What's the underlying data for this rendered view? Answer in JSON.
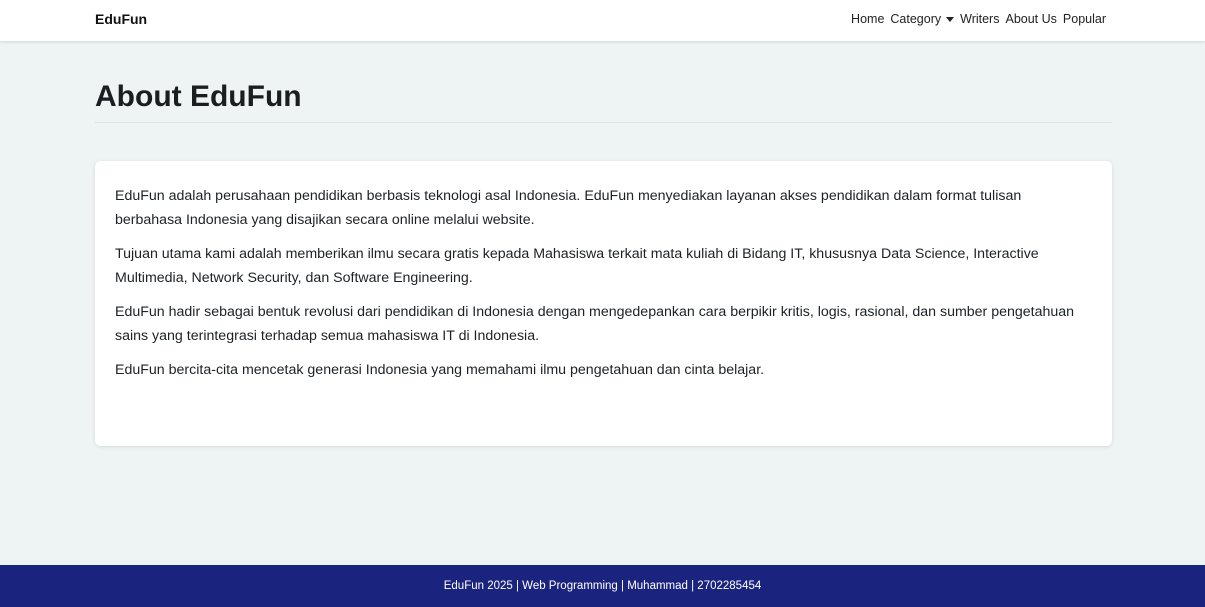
{
  "navbar": {
    "brand": "EduFun",
    "links": {
      "home": "Home",
      "category": "Category",
      "writers": "Writers",
      "about": "About Us",
      "popular": "Popular"
    }
  },
  "main": {
    "title": "About EduFun",
    "paragraphs": [
      "EduFun adalah perusahaan pendidikan berbasis teknologi asal Indonesia. EduFun menyediakan layanan akses pendidikan dalam format tulisan berbahasa Indonesia yang disajikan secara online melalui website.",
      "Tujuan utama kami adalah memberikan ilmu secara gratis kepada Mahasiswa terkait mata kuliah di Bidang IT, khususnya Data Science, Interactive Multimedia, Network Security, dan Software Engineering.",
      "EduFun hadir sebagai bentuk revolusi dari pendidikan di Indonesia dengan mengedepankan cara berpikir kritis, logis, rasional, dan sumber pengetahuan sains yang terintegrasi terhadap semua mahasiswa IT di Indonesia.",
      "EduFun bercita-cita mencetak generasi Indonesia yang memahami ilmu pengetahuan dan cinta belajar."
    ]
  },
  "footer": {
    "text": "EduFun 2025 | Web Programming | Muhammad | 2702285454"
  },
  "colors": {
    "background": "#eef3f3",
    "footer": "#1a237e",
    "card": "#ffffff"
  }
}
